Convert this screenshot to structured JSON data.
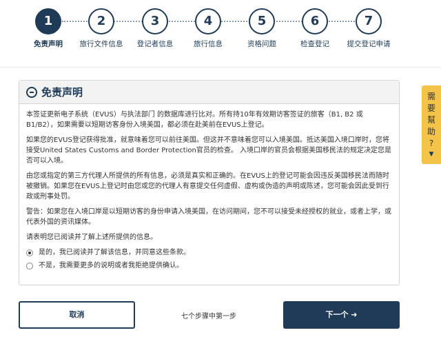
{
  "steps": [
    {
      "number": "1",
      "label": "免责声明",
      "active": true
    },
    {
      "number": "2",
      "label": "旅行文件信息",
      "active": false
    },
    {
      "number": "3",
      "label": "登记者信息",
      "active": false
    },
    {
      "number": "4",
      "label": "旅行信息",
      "active": false
    },
    {
      "number": "5",
      "label": "资格问题",
      "active": false
    },
    {
      "number": "6",
      "label": "检查登记",
      "active": false
    },
    {
      "number": "7",
      "label": "提交登记申请",
      "active": false
    }
  ],
  "panel": {
    "title": "免责声明",
    "paragraphs": [
      "本签证更新电子系统（EVUS）与执法部门 的数据库进行比对。所有持10年有效期访客签证的旅客（B1, B2 或 B1/B2），如果需要以短期访客身份入境美国，都必须在赴美前在EVUS上登记。",
      "如果您的EVUS登记获得批准，就意味着您可以前往美国。但这并不意味着您可以入境美国。抵达美国入境口岸时，您将接受United States Customs and Border Protection官员的检查。 入境口岸的官员会根据美国移民法的规定决定您是否可以入境。",
      "由您或指定的第三方代理人所提供的所有信息，必须是真实和正确的。在EVUS上的登记可能会因违反美国移民法而随时被撤销。如果您在EVUS上登记时由您或您的代理人有意提交任何虚假、虚构或伪造的声明或陈述，您可能会因此受到行政或刑事处罚。",
      "警告：如果您在入境口岸是以短期访客的身份申请入境美国，在访问期间，您不可以接受未经授权的就业，或者上学，或代表外国的资讯媒体。",
      "请表明您已阅读并了解上述所提供的信息。"
    ],
    "options": [
      {
        "label": "是的，我已阅读并了解该信息，并同意这些条款。",
        "checked": true
      },
      {
        "label": "不是，我需要更多的说明或者我拒绝提供确认。",
        "checked": false
      }
    ]
  },
  "help": {
    "chars": [
      "需",
      "要",
      "幫",
      "助",
      "?"
    ],
    "arrow": "▼"
  },
  "footer": {
    "cancel_label": "取消",
    "progress_text": "七个步骤中第一步",
    "next_label": "下一个 ➜"
  },
  "colors": {
    "primary": "#1f3b57",
    "help_tab": "#f3c34a"
  }
}
